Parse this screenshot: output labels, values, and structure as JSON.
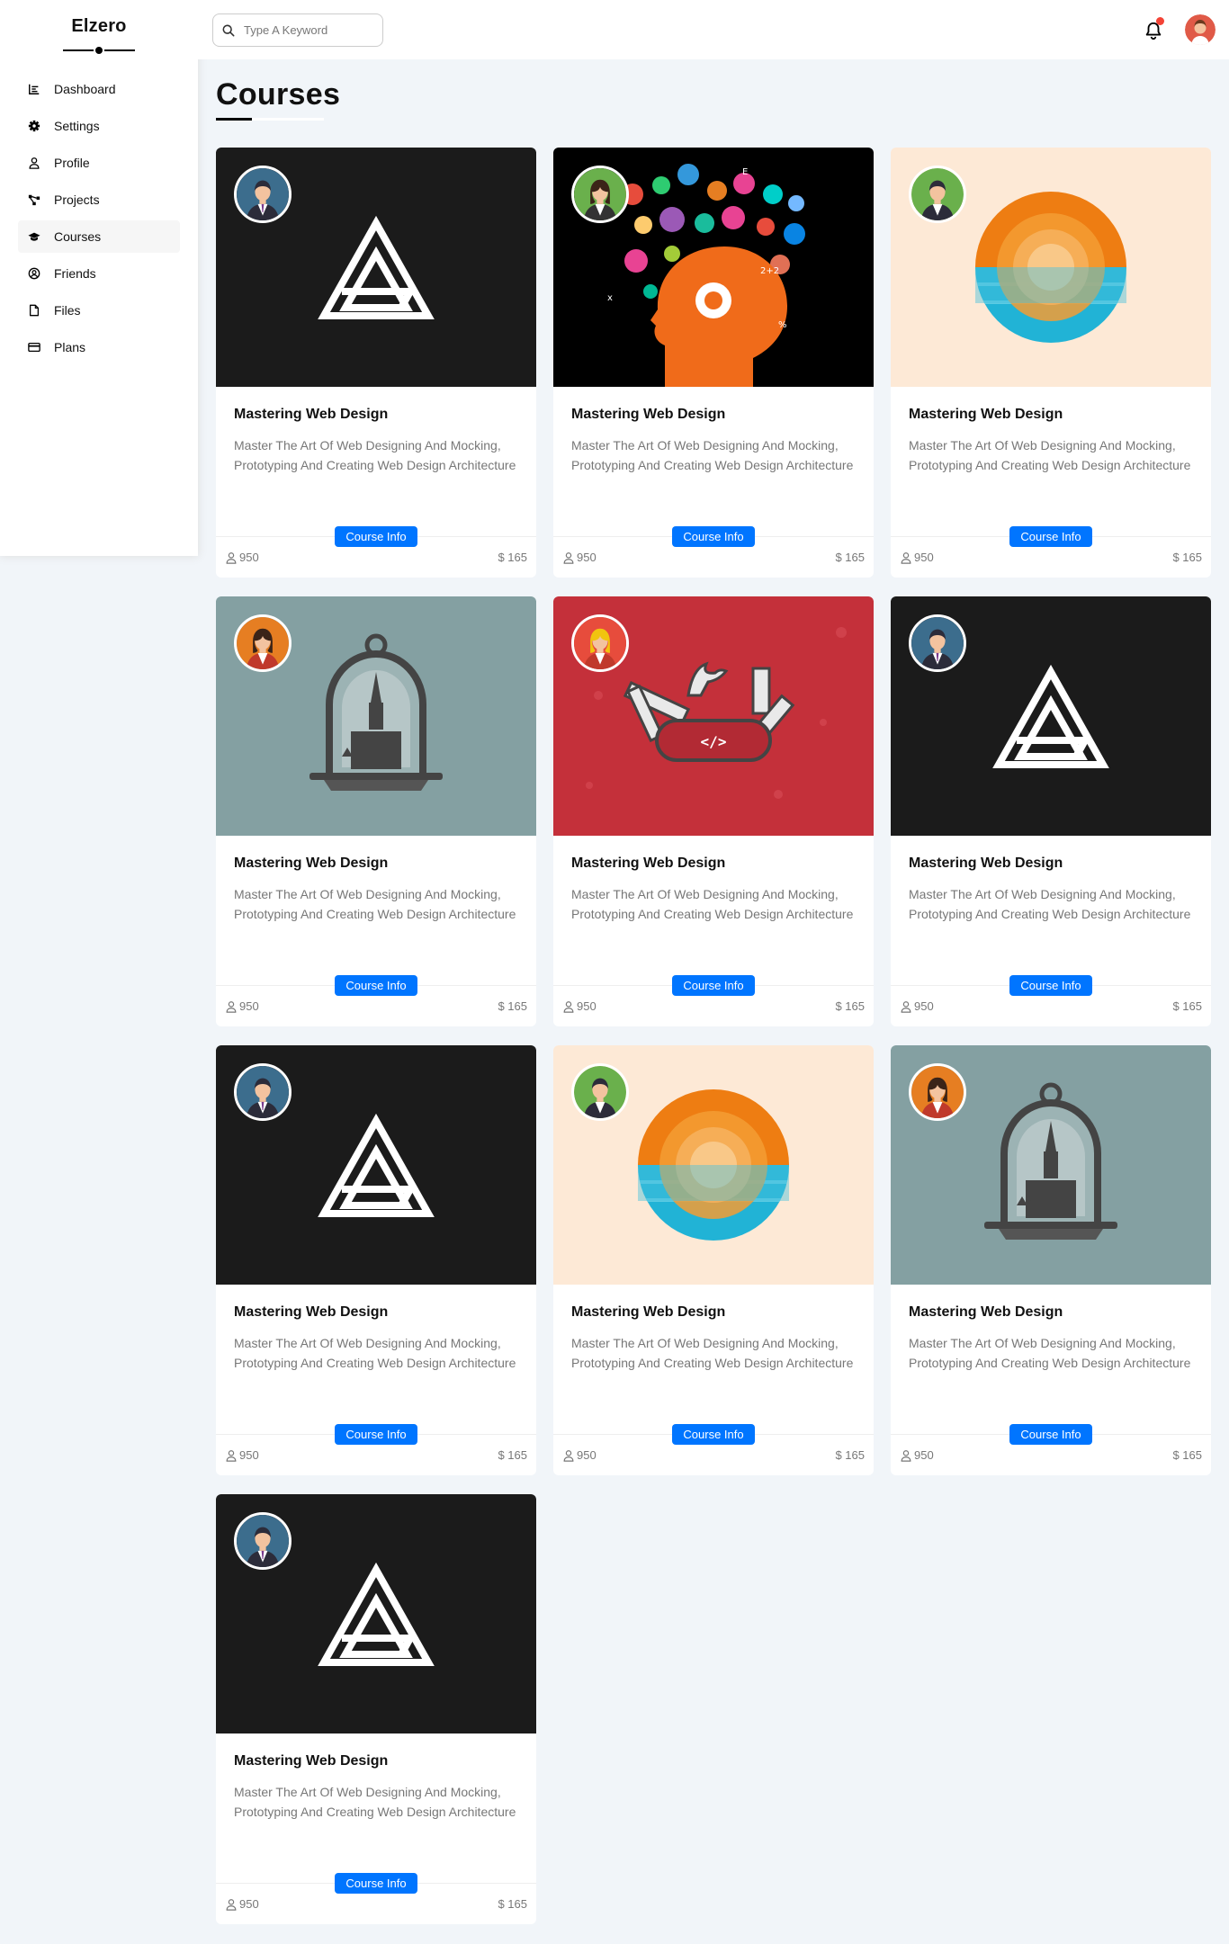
{
  "sidebar": {
    "brand": "Elzero",
    "items": [
      {
        "label": "Dashboard",
        "icon": "chart-icon"
      },
      {
        "label": "Settings",
        "icon": "gear-icon"
      },
      {
        "label": "Profile",
        "icon": "user-icon"
      },
      {
        "label": "Projects",
        "icon": "diagram-icon"
      },
      {
        "label": "Courses",
        "icon": "graduation-cap-icon",
        "active": true
      },
      {
        "label": "Friends",
        "icon": "user-circle-icon"
      },
      {
        "label": "Files",
        "icon": "file-icon"
      },
      {
        "label": "Plans",
        "icon": "credit-card-icon"
      }
    ]
  },
  "header": {
    "search_placeholder": "Type A Keyword",
    "notification_badge_color": "#f44336"
  },
  "page": {
    "title": "Courses"
  },
  "accent_color": "#0075ff",
  "courses": [
    {
      "title": "Mastering Web Design",
      "description": "Master The Art Of Web Designing And Mocking, Prototyping And Creating Web Design Architecture",
      "button": "Course Info",
      "students": "950",
      "price": "$ 165",
      "image": "logo-a",
      "avatar": "man-blue"
    },
    {
      "title": "Mastering Web Design",
      "description": "Master The Art Of Web Designing And Mocking, Prototyping And Creating Web Design Architecture",
      "button": "Course Info",
      "students": "950",
      "price": "$ 165",
      "image": "head-ideas",
      "avatar": "woman-green"
    },
    {
      "title": "Mastering Web Design",
      "description": "Master The Art Of Web Designing And Mocking, Prototyping And Creating Web Design Architecture",
      "button": "Course Info",
      "students": "950",
      "price": "$ 165",
      "image": "sunset-circle",
      "avatar": "man-green"
    },
    {
      "title": "Mastering Web Design",
      "description": "Master The Art Of Web Designing And Mocking, Prototyping And Creating Web Design Architecture",
      "button": "Course Info",
      "students": "950",
      "price": "$ 165",
      "image": "glass-dome",
      "avatar": "woman-orange"
    },
    {
      "title": "Mastering Web Design",
      "description": "Master The Art Of Web Designing And Mocking, Prototyping And Creating Web Design Architecture",
      "button": "Course Info",
      "students": "950",
      "price": "$ 165",
      "image": "swiss-knife",
      "avatar": "woman-red"
    },
    {
      "title": "Mastering Web Design",
      "description": "Master The Art Of Web Designing And Mocking, Prototyping And Creating Web Design Architecture",
      "button": "Course Info",
      "students": "950",
      "price": "$ 165",
      "image": "logo-a",
      "avatar": "man-blue"
    },
    {
      "title": "Mastering Web Design",
      "description": "Master The Art Of Web Designing And Mocking, Prototyping And Creating Web Design Architecture",
      "button": "Course Info",
      "students": "950",
      "price": "$ 165",
      "image": "logo-a",
      "avatar": "man-blue"
    },
    {
      "title": "Mastering Web Design",
      "description": "Master The Art Of Web Designing And Mocking, Prototyping And Creating Web Design Architecture",
      "button": "Course Info",
      "students": "950",
      "price": "$ 165",
      "image": "sunset-circle",
      "avatar": "man-green"
    },
    {
      "title": "Mastering Web Design",
      "description": "Master The Art Of Web Designing And Mocking, Prototyping And Creating Web Design Architecture",
      "button": "Course Info",
      "students": "950",
      "price": "$ 165",
      "image": "glass-dome",
      "avatar": "woman-orange"
    },
    {
      "title": "Mastering Web Design",
      "description": "Master The Art Of Web Designing And Mocking, Prototyping And Creating Web Design Architecture",
      "button": "Course Info",
      "students": "950",
      "price": "$ 165",
      "image": "logo-a",
      "avatar": "man-blue"
    }
  ]
}
